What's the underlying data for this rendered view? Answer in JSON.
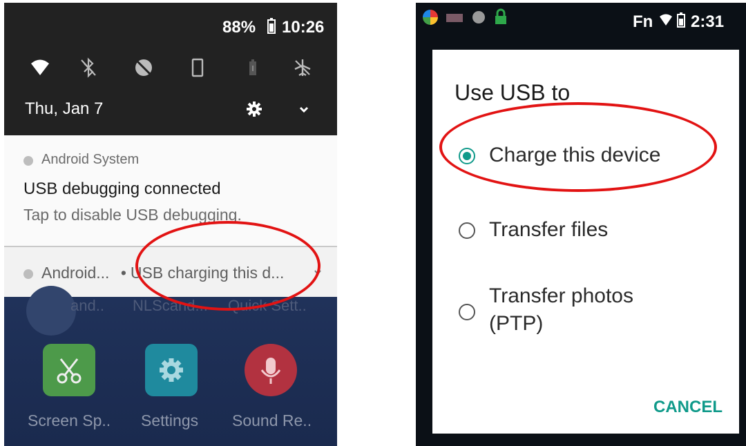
{
  "left_phone": {
    "status": {
      "battery": "88%",
      "time": "10:26"
    },
    "quick_settings_icons": [
      "wifi-icon",
      "bluetooth-off-icon",
      "data-saver-icon",
      "portrait-icon",
      "battery-saver-icon",
      "airplane-mode-off-icon"
    ],
    "date": "Thu, Jan 7",
    "notification1": {
      "app": "Android System",
      "title": "USB debugging connected",
      "body": "Tap to disable USB debugging."
    },
    "notification2": {
      "app": "Android...",
      "separator": "•",
      "text": "USB charging this d..."
    },
    "home_faded_labels": [
      "and..",
      "NLScand...",
      "Quick Sett.."
    ],
    "dock": {
      "apps": [
        "Screen Sp..",
        "Settings",
        "Sound Re.."
      ]
    }
  },
  "right_phone": {
    "status": {
      "fn": "Fn",
      "time": "2:31"
    },
    "dialog": {
      "title": "Use USB to",
      "options": [
        {
          "label": "Charge this device",
          "selected": true
        },
        {
          "label": "Transfer files",
          "selected": false
        },
        {
          "label_line1": "Transfer photos",
          "label_line2": "(PTP)",
          "selected": false
        }
      ],
      "cancel": "CANCEL"
    }
  },
  "colors": {
    "accent": "#109a8a",
    "highlight": "#e21313",
    "shade": "#222222"
  }
}
